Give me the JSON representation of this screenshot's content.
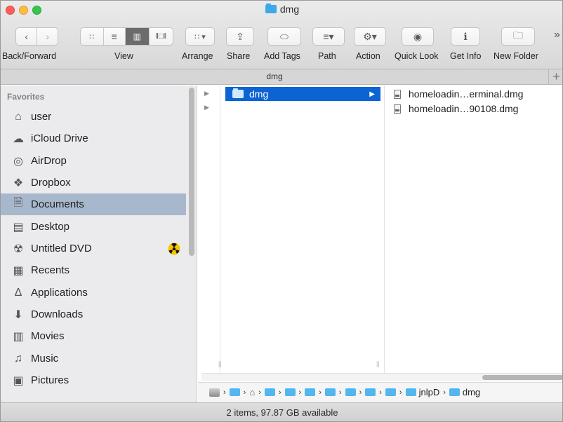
{
  "window": {
    "title": "dmg"
  },
  "toolbar": {
    "back_forward_label": "Back/Forward",
    "view_label": "View",
    "arrange_label": "Arrange",
    "share_label": "Share",
    "add_tags_label": "Add Tags",
    "path_label": "Path",
    "action_label": "Action",
    "quick_look_label": "Quick Look",
    "get_info_label": "Get Info",
    "new_folder_label": "New Folder",
    "overflow": "»",
    "view_active": "columns"
  },
  "tabbar": {
    "title": "dmg",
    "add_tab": "+"
  },
  "sidebar": {
    "header": "Favorites",
    "items": [
      {
        "label": "user",
        "icon": "home-icon"
      },
      {
        "label": "iCloud Drive",
        "icon": "cloud-icon"
      },
      {
        "label": "AirDrop",
        "icon": "airdrop-icon"
      },
      {
        "label": "Dropbox",
        "icon": "dropbox-icon"
      },
      {
        "label": "Documents",
        "icon": "documents-icon",
        "selected": true
      },
      {
        "label": "Desktop",
        "icon": "desktop-icon"
      },
      {
        "label": "Untitled DVD",
        "icon": "dvd-icon"
      },
      {
        "label": "Recents",
        "icon": "recents-icon"
      },
      {
        "label": "Applications",
        "icon": "applications-icon"
      },
      {
        "label": "Downloads",
        "icon": "downloads-icon"
      },
      {
        "label": "Movies",
        "icon": "movies-icon"
      },
      {
        "label": "Music",
        "icon": "music-icon"
      },
      {
        "label": "Pictures",
        "icon": "pictures-icon"
      }
    ]
  },
  "columns": {
    "selected_folder": "dmg",
    "files": [
      "homeloadin…erminal.dmg",
      "homeloadin…90108.dmg"
    ]
  },
  "pathbar": {
    "segments": [
      "jnlpD",
      "dmg"
    ]
  },
  "status": {
    "text": "2 items, 97.87 GB available"
  },
  "colors": {
    "selection": "#0c63d3",
    "sidebar_selected": "#a8b8cc",
    "folder": "#3fa9e8"
  }
}
